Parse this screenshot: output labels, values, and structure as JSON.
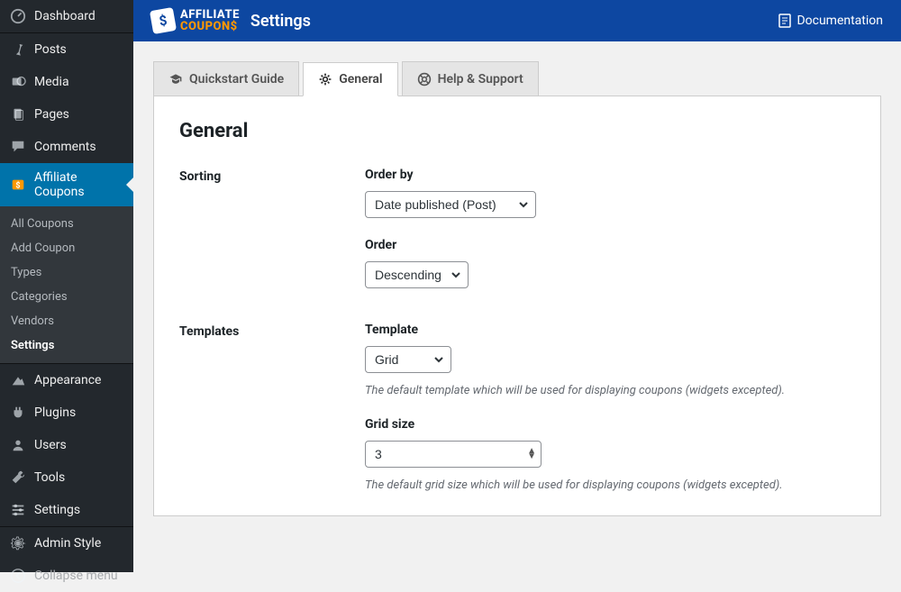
{
  "sidebar": {
    "items": [
      {
        "label": "Dashboard",
        "icon": "dashboard-icon"
      },
      {
        "label": "Posts",
        "icon": "pin-icon"
      },
      {
        "label": "Media",
        "icon": "media-icon"
      },
      {
        "label": "Pages",
        "icon": "pages-icon"
      },
      {
        "label": "Comments",
        "icon": "comments-icon"
      },
      {
        "label": "Affiliate Coupons",
        "icon": "coupon-icon"
      },
      {
        "label": "Appearance",
        "icon": "appearance-icon"
      },
      {
        "label": "Plugins",
        "icon": "plugins-icon"
      },
      {
        "label": "Users",
        "icon": "users-icon"
      },
      {
        "label": "Tools",
        "icon": "tools-icon"
      },
      {
        "label": "Settings",
        "icon": "settings-icon"
      },
      {
        "label": "Admin Style",
        "icon": "gear-icon"
      },
      {
        "label": "Collapse menu",
        "icon": "collapse-icon"
      }
    ],
    "submenu": [
      {
        "label": "All Coupons"
      },
      {
        "label": "Add Coupon"
      },
      {
        "label": "Types"
      },
      {
        "label": "Categories"
      },
      {
        "label": "Vendors"
      },
      {
        "label": "Settings"
      }
    ]
  },
  "topbar": {
    "brand_line1": "AFFILIATE",
    "brand_line2": "COUPON$",
    "title": "Settings",
    "doc_label": "Documentation"
  },
  "tabs": [
    {
      "label": "Quickstart Guide"
    },
    {
      "label": "General"
    },
    {
      "label": "Help & Support"
    }
  ],
  "panel": {
    "heading": "General",
    "sections": [
      {
        "label": "Sorting",
        "fields": [
          {
            "label": "Order by",
            "type": "select",
            "value": "Date published (Post)"
          },
          {
            "label": "Order",
            "type": "select",
            "value": "Descending"
          }
        ]
      },
      {
        "label": "Templates",
        "fields": [
          {
            "label": "Template",
            "type": "select",
            "value": "Grid",
            "help": "The default template which will be used for displaying coupons (widgets excepted)."
          },
          {
            "label": "Grid size",
            "type": "number",
            "value": "3",
            "help": "The default grid size which will be used for displaying coupons (widgets excepted)."
          }
        ]
      }
    ]
  }
}
